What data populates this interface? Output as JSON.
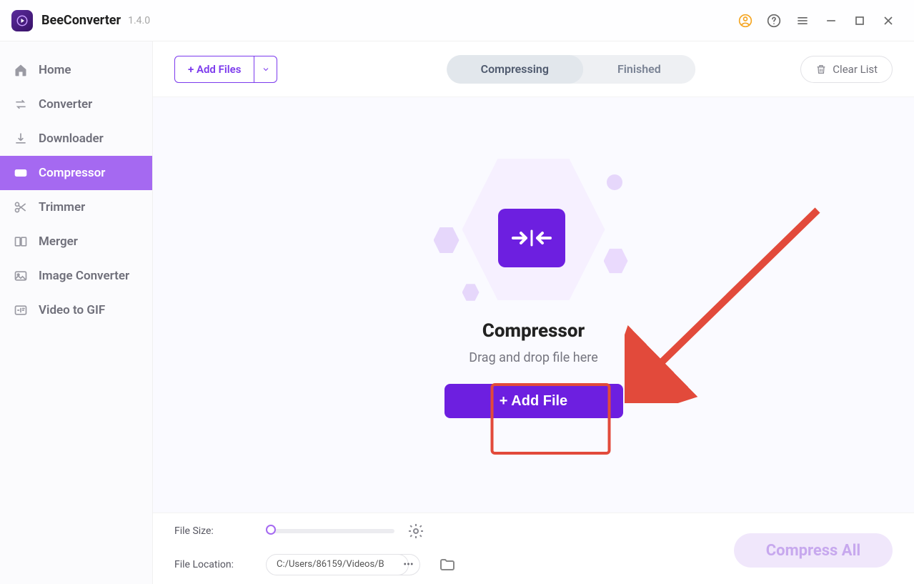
{
  "app": {
    "title": "BeeConverter",
    "version": "1.4.0"
  },
  "sidebar": {
    "items": [
      {
        "label": "Home"
      },
      {
        "label": "Converter"
      },
      {
        "label": "Downloader"
      },
      {
        "label": "Compressor"
      },
      {
        "label": "Trimmer"
      },
      {
        "label": "Merger"
      },
      {
        "label": "Image Converter"
      },
      {
        "label": "Video to GIF"
      }
    ]
  },
  "toolbar": {
    "add_files_label": "+ Add Files",
    "tabs": [
      {
        "label": "Compressing"
      },
      {
        "label": "Finished"
      }
    ],
    "clear_list_label": "Clear List"
  },
  "content": {
    "title": "Compressor",
    "subtitle": "Drag and drop file here",
    "add_file_label": "+ Add File"
  },
  "footer": {
    "file_size_label": "File Size:",
    "file_location_label": "File Location:",
    "file_location_value": "C:/Users/86159/Videos/B",
    "compress_all_label": "Compress All"
  }
}
